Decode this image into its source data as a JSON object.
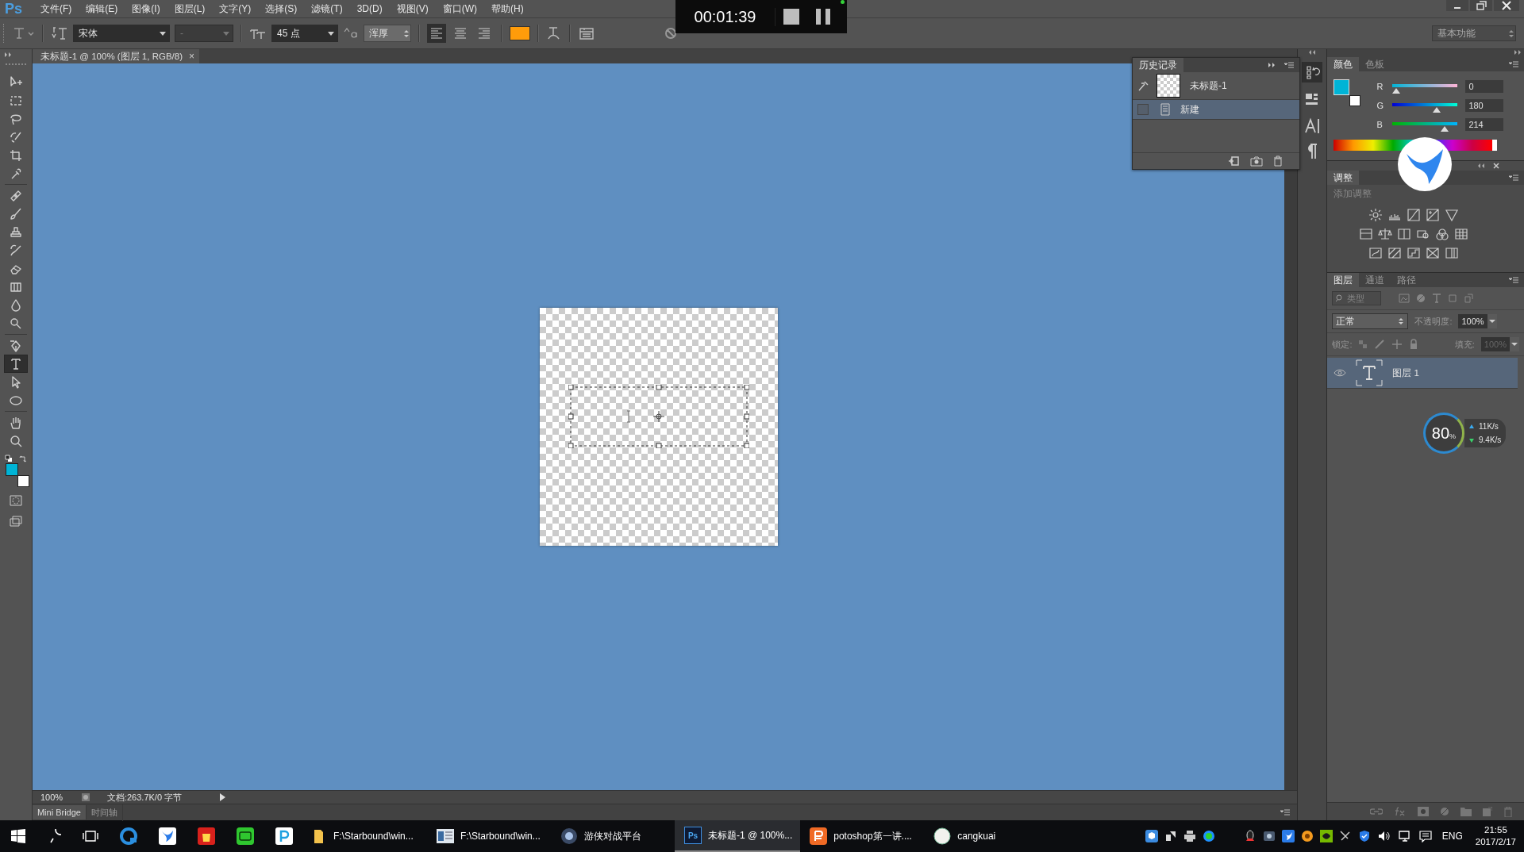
{
  "menu_bar": {
    "logo": "Ps",
    "items": [
      "文件(F)",
      "编辑(E)",
      "图像(I)",
      "图层(L)",
      "文字(Y)",
      "选择(S)",
      "滤镜(T)",
      "3D(D)",
      "视图(V)",
      "窗口(W)",
      "帮助(H)"
    ]
  },
  "options_bar": {
    "font_family": "宋体",
    "font_style": "-",
    "font_size": "45 点",
    "anti_alias": "浑厚",
    "alignment": [
      {
        "selected": true
      },
      {
        "selected": false
      },
      {
        "selected": false
      }
    ]
  },
  "recorder": {
    "time": "00:01:39"
  },
  "workspace": "基本功能",
  "document_tab": {
    "title": "未标题-1 @ 100% (图层 1, RGB/8)",
    "close": "×"
  },
  "tools": [
    {
      "kind": "move",
      "selected": false
    },
    {
      "kind": "marquee",
      "selected": false
    },
    {
      "kind": "lasso",
      "selected": false
    },
    {
      "kind": "quickselect",
      "selected": false
    },
    {
      "kind": "crop",
      "selected": false
    },
    {
      "kind": "eyedropper",
      "selected": false
    },
    {
      "kind": "healing",
      "selected": false
    },
    {
      "kind": "brush",
      "selected": false
    },
    {
      "kind": "stamp",
      "selected": false
    },
    {
      "kind": "historybrush",
      "selected": false
    },
    {
      "kind": "eraser",
      "selected": false
    },
    {
      "kind": "gradient",
      "selected": false
    },
    {
      "kind": "blur",
      "selected": false
    },
    {
      "kind": "dodge",
      "selected": false
    },
    {
      "kind": "pen",
      "selected": false
    },
    {
      "kind": "type",
      "selected": true
    },
    {
      "kind": "pathselect",
      "selected": false
    },
    {
      "kind": "ellipse",
      "selected": false
    },
    {
      "kind": "hand",
      "selected": false
    },
    {
      "kind": "zoom",
      "selected": false
    }
  ],
  "history_panel": {
    "tab": "历史记录",
    "items": [
      {
        "kind": "snapshot",
        "name": "未标题-1",
        "selected": false
      },
      {
        "kind": "step",
        "name": "新建",
        "selected": true
      }
    ]
  },
  "color_panel": {
    "tabs": [
      {
        "label": "颜色",
        "selected": true
      },
      {
        "label": "色板",
        "selected": false
      }
    ],
    "channels": [
      {
        "name": "R",
        "value": "0",
        "level": 0
      },
      {
        "name": "G",
        "value": "180",
        "level": 0.706
      },
      {
        "name": "B",
        "value": "214",
        "level": 0.839
      }
    ]
  },
  "adjustments_panel": {
    "tab": "调整",
    "hint": "添加调整"
  },
  "layers_panel": {
    "tabs": [
      {
        "label": "图层",
        "selected": true
      },
      {
        "label": "通道",
        "selected": false
      },
      {
        "label": "路径",
        "selected": false
      }
    ],
    "filter": "类型",
    "blend_mode": "正常",
    "opacity_label": "不透明度:",
    "opacity": "100%",
    "lock_label": "锁定:",
    "fill_label": "填充:",
    "fill": "100%",
    "layers": [
      {
        "kind": "text",
        "name": "图层 1",
        "visible": true,
        "selected": true
      }
    ]
  },
  "status_bar": {
    "zoom": "100%",
    "doc_info": "文档:263.7K/0 字节"
  },
  "bottom_tabs": [
    {
      "label": "Mini Bridge",
      "selected": true
    },
    {
      "label": "时间轴",
      "selected": false
    }
  ],
  "network_widget": {
    "percent": "80",
    "unit": "%",
    "upload": "11K/s",
    "download": "9.4K/s"
  },
  "taskbar": {
    "windows": [
      {
        "kind": "folder",
        "label": "F:\\Starbound\\win...",
        "selected": false
      },
      {
        "kind": "document",
        "label": "F:\\Starbound\\win...",
        "selected": false
      },
      {
        "kind": "game",
        "label": "游侠对战平台",
        "selected": false
      },
      {
        "kind": "photoshop",
        "icon_text": "Ps",
        "label": "未标题-1 @ 100%...",
        "selected": true
      },
      {
        "kind": "slides",
        "label": "potoshop第一讲....",
        "selected": false
      },
      {
        "kind": "avatar",
        "label": "cangkuai",
        "selected": false
      }
    ],
    "language": "ENG",
    "time": "21:55",
    "date": "2017/2/17"
  }
}
